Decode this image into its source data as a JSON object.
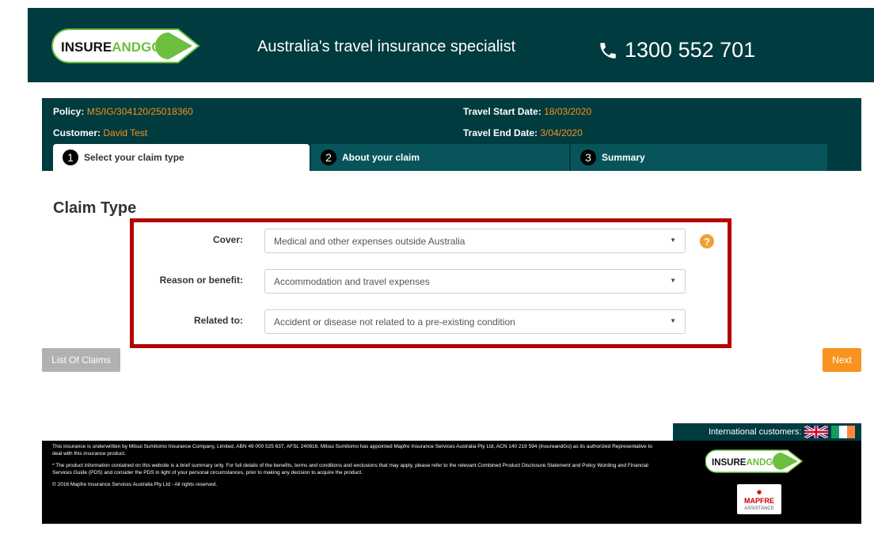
{
  "header": {
    "logo_insure": "INSURE",
    "logo_and": "AND",
    "logo_go": "GO",
    "tagline": "Australia's travel insurance specialist",
    "phone": "1300 552 701"
  },
  "policy": {
    "policy_label": "Policy:",
    "policy_value": "MS/IG/304120/25018360",
    "customer_label": "Customer:",
    "customer_value": "David Test",
    "start_label": "Travel Start Date:",
    "start_value": "18/03/2020",
    "end_label": "Travel End Date:",
    "end_value": "3/04/2020"
  },
  "tabs": [
    {
      "num": "1",
      "label": "Select your claim type"
    },
    {
      "num": "2",
      "label": "About your claim"
    },
    {
      "num": "3",
      "label": "Summary"
    }
  ],
  "claim": {
    "title": "Claim Type",
    "fields": [
      {
        "label": "Cover:",
        "value": "Medical and other expenses outside Australia"
      },
      {
        "label": "Reason or benefit:",
        "value": "Accommodation and travel expenses"
      },
      {
        "label": "Related to:",
        "value": "Accident or disease not related to a pre-existing condition"
      }
    ],
    "help": "?"
  },
  "buttons": {
    "list_of_claims": "List Of Claims",
    "next": "Next"
  },
  "footer": {
    "international": "International customers:",
    "para1": "This insurance is underwritten by Mitsui Sumitomo Insurance Company, Limited, ABN 49 000 525 637, AFSL 240816. Mitsui Sumitomo has appointed Mapfre Insurance Services Australia Pty Ltd, ACN 140 219 594 (InsureandGo) as its authorized Representative to deal with this insurance product.",
    "para2": "* The product information contained on this website is a brief summary only. For full details of the benefits, terms and conditions and exclusions that may apply, please refer to the relevant Combined Product Disclosure Statement and Policy Wording and Financial Services Guide (PDS) and consider the PDS in light of your personal circumstances, prior to making any decision to acquire the product.",
    "copyright": "© 2016 Mapfre Insurance Services Australia Pty Ltd - All rights reserved.",
    "mapfre": "MAPFRE",
    "assistance": "ASSISTANCE"
  },
  "colors": {
    "brand_dark": "#003b3f",
    "accent_orange": "#f7931e",
    "highlight_red": "#b40000",
    "logo_green": "#6cbf3f"
  }
}
